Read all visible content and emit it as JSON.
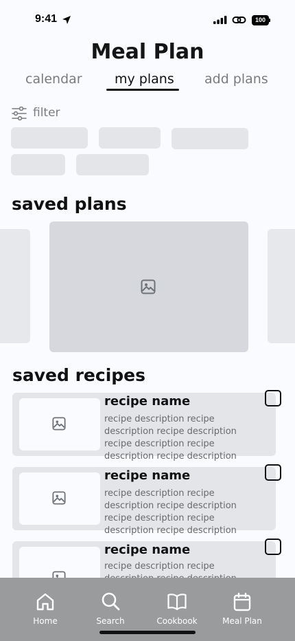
{
  "status": {
    "time": "9:41",
    "battery": "100"
  },
  "header": {
    "title": "Meal Plan"
  },
  "tabs": [
    {
      "label": "calendar"
    },
    {
      "label": "my plans"
    },
    {
      "label": "add plans"
    }
  ],
  "filter": {
    "label": "filter"
  },
  "saved_plans": {
    "title": "saved plans"
  },
  "saved_recipes": {
    "title": "saved recipes",
    "items": [
      {
        "name": "recipe name",
        "description": "recipe description recipe description recipe description recipe description recipe description recipe description"
      },
      {
        "name": "recipe name",
        "description": "recipe description recipe description recipe description recipe description recipe description recipe description"
      },
      {
        "name": "recipe name",
        "description": "recipe description recipe description recipe description recipe description recipe description recipe description"
      }
    ]
  },
  "nav": [
    {
      "label": "Home",
      "icon": "home-icon"
    },
    {
      "label": "Search",
      "icon": "search-icon"
    },
    {
      "label": "Cookbook",
      "icon": "book-icon"
    },
    {
      "label": "Meal Plan",
      "icon": "calendar-icon"
    }
  ]
}
